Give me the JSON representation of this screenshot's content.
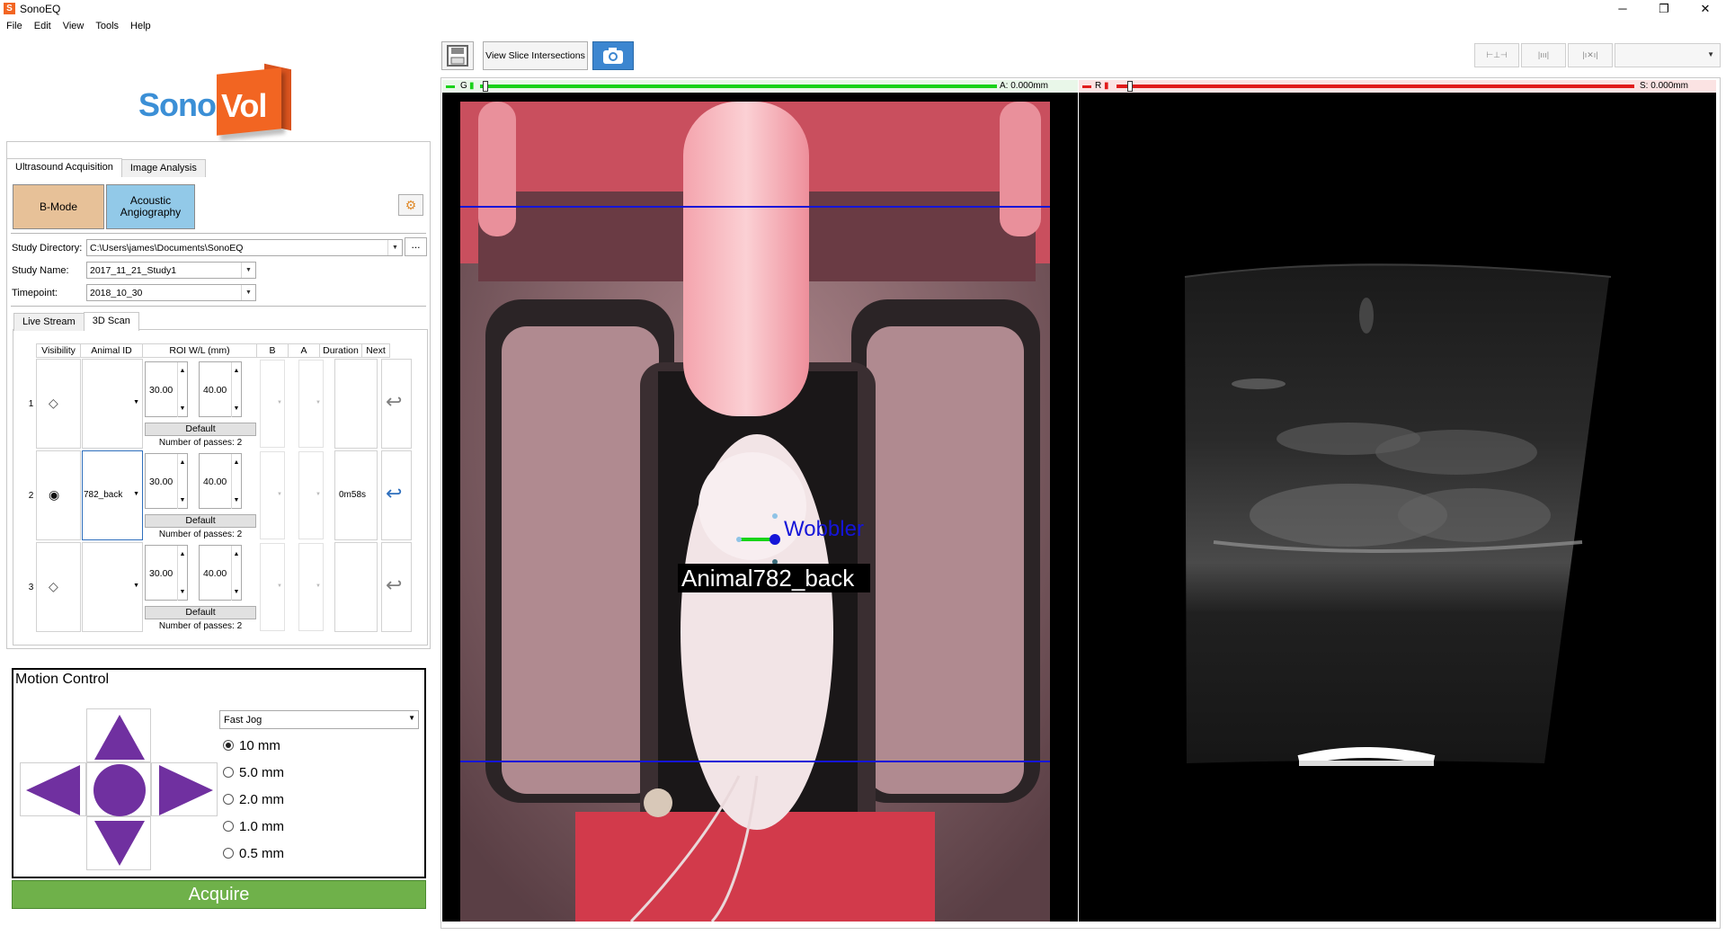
{
  "window": {
    "app_title": "SonoEQ",
    "app_icon_letter": "S",
    "minimize": "─",
    "maximize": "❐",
    "close": "✕"
  },
  "menu": [
    "File",
    "Edit",
    "View",
    "Tools",
    "Help"
  ],
  "logo": {
    "sono": "Sono",
    "vol": "Vol"
  },
  "main_tabs": [
    {
      "label": "Ultrasound Acquisition",
      "active": true
    },
    {
      "label": "Image Analysis",
      "active": false
    }
  ],
  "modes": {
    "bmode": "B-Mode",
    "acoustic": "Acoustic Angiography"
  },
  "study": {
    "directory_label": "Study Directory:",
    "directory_value": "C:\\Users\\james\\Documents\\SonoEQ",
    "browse": "...",
    "name_label": "Study Name:",
    "name_value": "2017_11_21_Study1",
    "timepoint_label": "Timepoint:",
    "timepoint_value": "2018_10_30"
  },
  "sub_tabs": [
    {
      "label": "Live Stream",
      "active": false
    },
    {
      "label": "3D Scan",
      "active": true
    }
  ],
  "scan_table": {
    "headers": [
      "Visibility",
      "Animal ID",
      "ROI W/L (mm)",
      "B",
      "A",
      "Duration",
      "Next"
    ],
    "rows": [
      {
        "num": "1",
        "visible": false,
        "animal_id": "",
        "roi_w": "30.00",
        "roi_l": "40.00",
        "default": "Default",
        "passes": "Number of passes: 2",
        "duration": "",
        "next_active": false
      },
      {
        "num": "2",
        "visible": true,
        "animal_id": "782_back",
        "roi_w": "30.00",
        "roi_l": "40.00",
        "default": "Default",
        "passes": "Number of passes: 2",
        "duration": "0m58s",
        "next_active": true
      },
      {
        "num": "3",
        "visible": false,
        "animal_id": "",
        "roi_w": "30.00",
        "roi_l": "40.00",
        "default": "Default",
        "passes": "Number of passes: 2",
        "duration": "",
        "next_active": false
      }
    ]
  },
  "motion": {
    "title": "Motion Control",
    "speed": "Fast Jog",
    "steps": [
      {
        "label": "10 mm",
        "selected": true
      },
      {
        "label": "5.0 mm",
        "selected": false
      },
      {
        "label": "2.0 mm",
        "selected": false
      },
      {
        "label": "1.0 mm",
        "selected": false
      },
      {
        "label": "0.5 mm",
        "selected": false
      }
    ],
    "color": "#7030a0"
  },
  "acquire": "Acquire",
  "toolbar": {
    "view_slice": "View Slice Intersections"
  },
  "views": {
    "green_bar": {
      "left_label": "G",
      "readout": "A: 0.000mm",
      "color": "#19d219"
    },
    "red_bar": {
      "left_label": "R",
      "readout": "S: 0.000mm",
      "color": "#e11b1b"
    },
    "overlay_wobbler": "Wobbler",
    "overlay_animal": "Animal782_back"
  }
}
